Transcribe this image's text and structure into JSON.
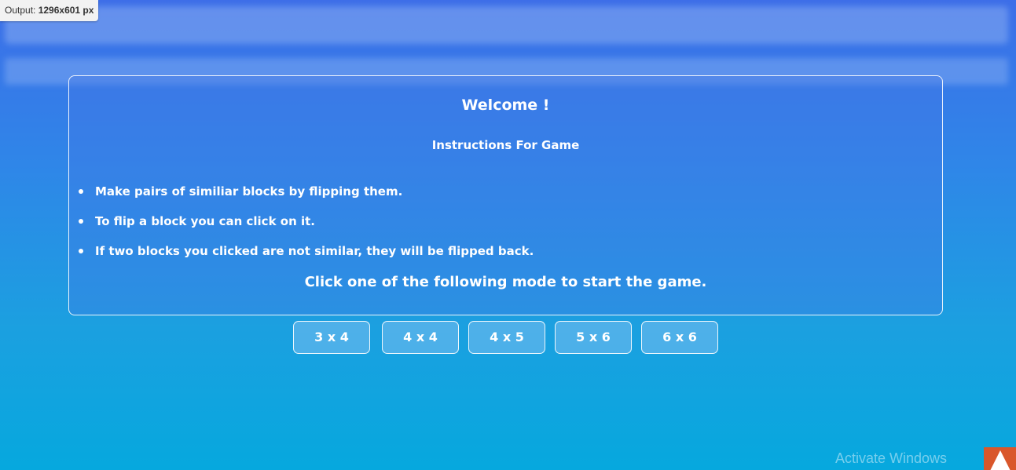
{
  "output_badge": {
    "label": "Output: ",
    "size": "1296x601 px"
  },
  "panel": {
    "welcome": "Welcome !",
    "subtitle": "Instructions For Game",
    "instructions": [
      "Make pairs of similiar blocks by flipping them.",
      "To flip a block you can click on it.",
      "If two blocks you clicked are not similar, they will be flipped back."
    ],
    "start_prompt": "Click one of the following mode to start the game."
  },
  "modes": [
    {
      "label": "3 x 4"
    },
    {
      "label": "4 x 4"
    },
    {
      "label": "4 x 5"
    },
    {
      "label": "5 x 6"
    },
    {
      "label": "6 x 6"
    }
  ],
  "watermark": "Activate Windows",
  "colors": {
    "background_top": "#3d6ee8",
    "background_bottom": "#06a8de",
    "text": "#ffffff",
    "corner_tile": "#d9572b"
  }
}
